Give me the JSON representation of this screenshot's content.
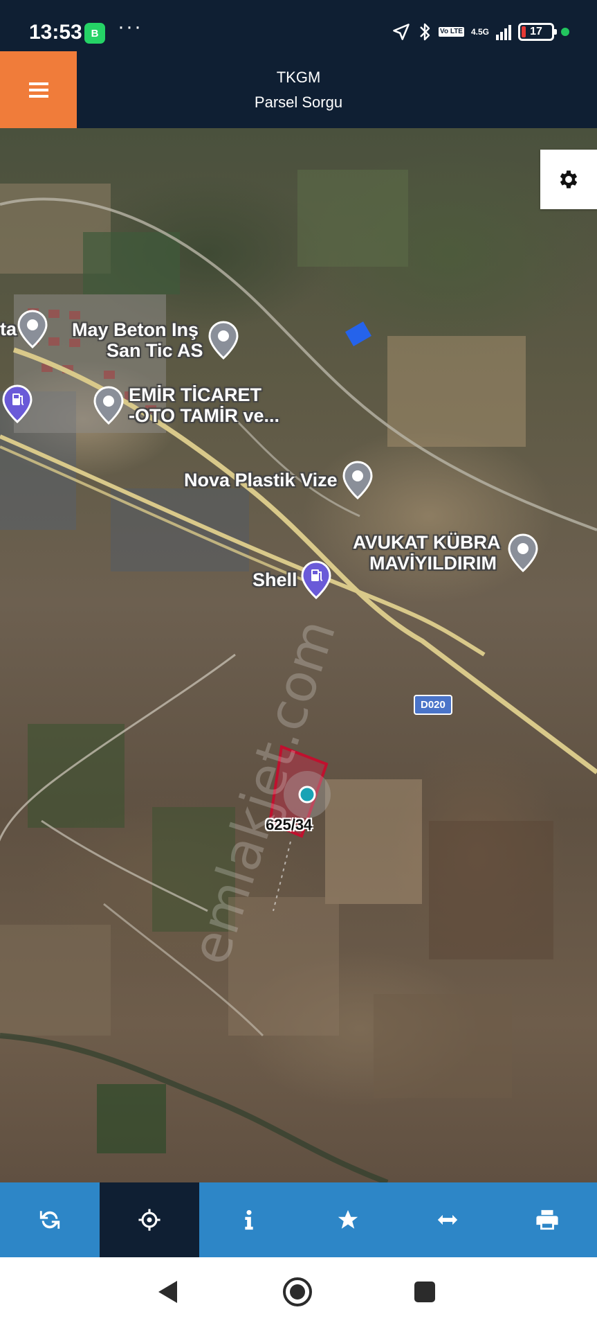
{
  "status_bar": {
    "time": "13:53",
    "whatsapp_badge": "B",
    "more": "···",
    "network_top": "4.5G",
    "network_vo": "Vo LTE",
    "battery": "17"
  },
  "header": {
    "title": "TKGM",
    "subtitle": "Parsel Sorgu"
  },
  "map": {
    "pois": [
      {
        "label": "ta",
        "icon": "location-pin"
      },
      {
        "label": "May Beton Inş San Tic AS",
        "line1": "May Beton Inş",
        "line2": "San Tic AS",
        "icon": "location-pin"
      },
      {
        "label": "fuel",
        "icon": "fuel-pin"
      },
      {
        "label": "EMİR TİCARET -OTO TAMİR ve...",
        "line1": "EMİR TİCARET",
        "line2": "-OTO TAMİR ve...",
        "icon": "location-pin"
      },
      {
        "label": "Nova Plastik Vize",
        "icon": "location-pin"
      },
      {
        "label": "AVUKAT KÜBRA MAVİYILDIRIM",
        "line1": "AVUKAT KÜBRA",
        "line2": "MAVİYILDIRIM",
        "icon": "location-pin"
      },
      {
        "label": "Shell",
        "icon": "fuel-pin"
      }
    ],
    "road_badge": "D020",
    "parcel_label": "625/34",
    "watermark": "emlakjet.com"
  },
  "toolbar": {
    "items": [
      {
        "name": "refresh",
        "icon": "refresh-icon",
        "active": false
      },
      {
        "name": "locate",
        "icon": "crosshair-icon",
        "active": true
      },
      {
        "name": "info",
        "icon": "info-icon",
        "active": false
      },
      {
        "name": "favorite",
        "icon": "star-icon",
        "active": false
      },
      {
        "name": "measure",
        "icon": "arrows-horizontal-icon",
        "active": false
      },
      {
        "name": "print",
        "icon": "print-icon",
        "active": false
      }
    ]
  },
  "colors": {
    "header_bg": "#0f1f33",
    "menu_bg": "#f07c3a",
    "toolbar_bg": "#2d86c7",
    "parcel_border": "#c0102e"
  }
}
